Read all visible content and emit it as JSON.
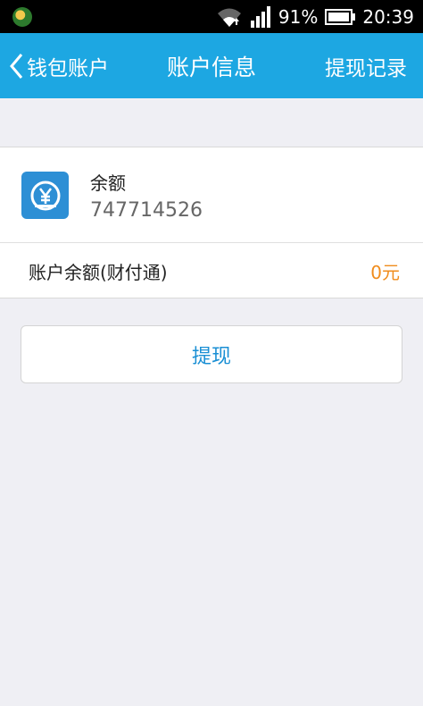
{
  "status_bar": {
    "battery_percent": "91%",
    "time": "20:39"
  },
  "header": {
    "back_label": "钱包账户",
    "title": "账户信息",
    "records_label": "提现记录"
  },
  "account": {
    "balance_label": "余额",
    "account_number": "747714526",
    "provider_label": "账户余额(财付通)",
    "provider_value": "0元"
  },
  "actions": {
    "withdraw_label": "提现"
  },
  "colors": {
    "header_bg": "#1da7e2",
    "icon_bg": "#2d8fd5",
    "amount": "#f08c1c",
    "button_text": "#1a8fd4"
  }
}
